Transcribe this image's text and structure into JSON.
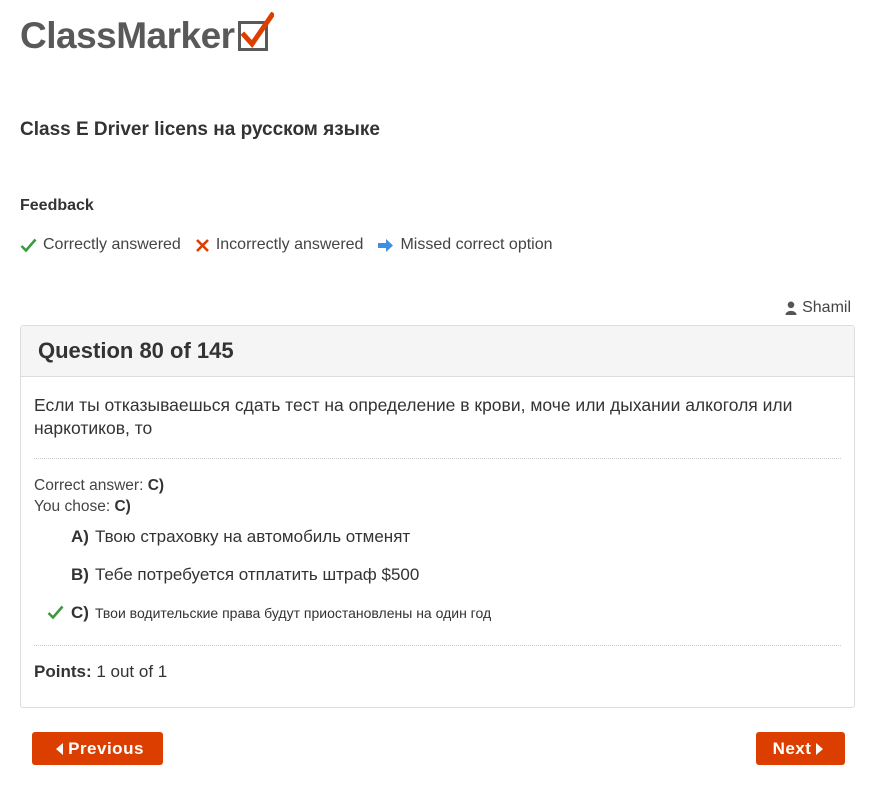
{
  "brand": {
    "name": "ClassMarker",
    "accent_color": "#dc3e00"
  },
  "test": {
    "title": "Class E Driver licens на русском языке"
  },
  "feedback": {
    "heading": "Feedback",
    "legend": [
      {
        "icon": "check-icon",
        "label": "Correctly answered",
        "color": "#3c9a3c"
      },
      {
        "icon": "cross-icon",
        "label": "Incorrectly answered",
        "color": "#dc3e00"
      },
      {
        "icon": "arrow-right-icon",
        "label": "Missed correct option",
        "color": "#3d8fe0"
      }
    ]
  },
  "user": {
    "icon": "user-icon",
    "name": "Shamil"
  },
  "question": {
    "header": "Question 80 of 145",
    "text": "Если ты отказываешься сдать тест на определение в крови, моче или дыхании алкоголя или наркотиков, то",
    "correct_answer_label": "Correct answer:",
    "correct_answer_value": "C)",
    "you_chose_label": "You chose:",
    "you_chose_value": "C)",
    "options": [
      {
        "letter": "A)",
        "text": "Твою страховку на автомобиль отменят",
        "marked": false
      },
      {
        "letter": "B)",
        "text": "Тебе потребуется отплатить штраф $500",
        "marked": false
      },
      {
        "letter": "C)",
        "text": "Твои водительские права будут приостановлены на один год",
        "marked": true,
        "mark_icon": "check-icon"
      }
    ],
    "points_label": "Points:",
    "points_value": "1 out of 1"
  },
  "navigation": {
    "previous_label": "Previous",
    "next_label": "Next"
  }
}
